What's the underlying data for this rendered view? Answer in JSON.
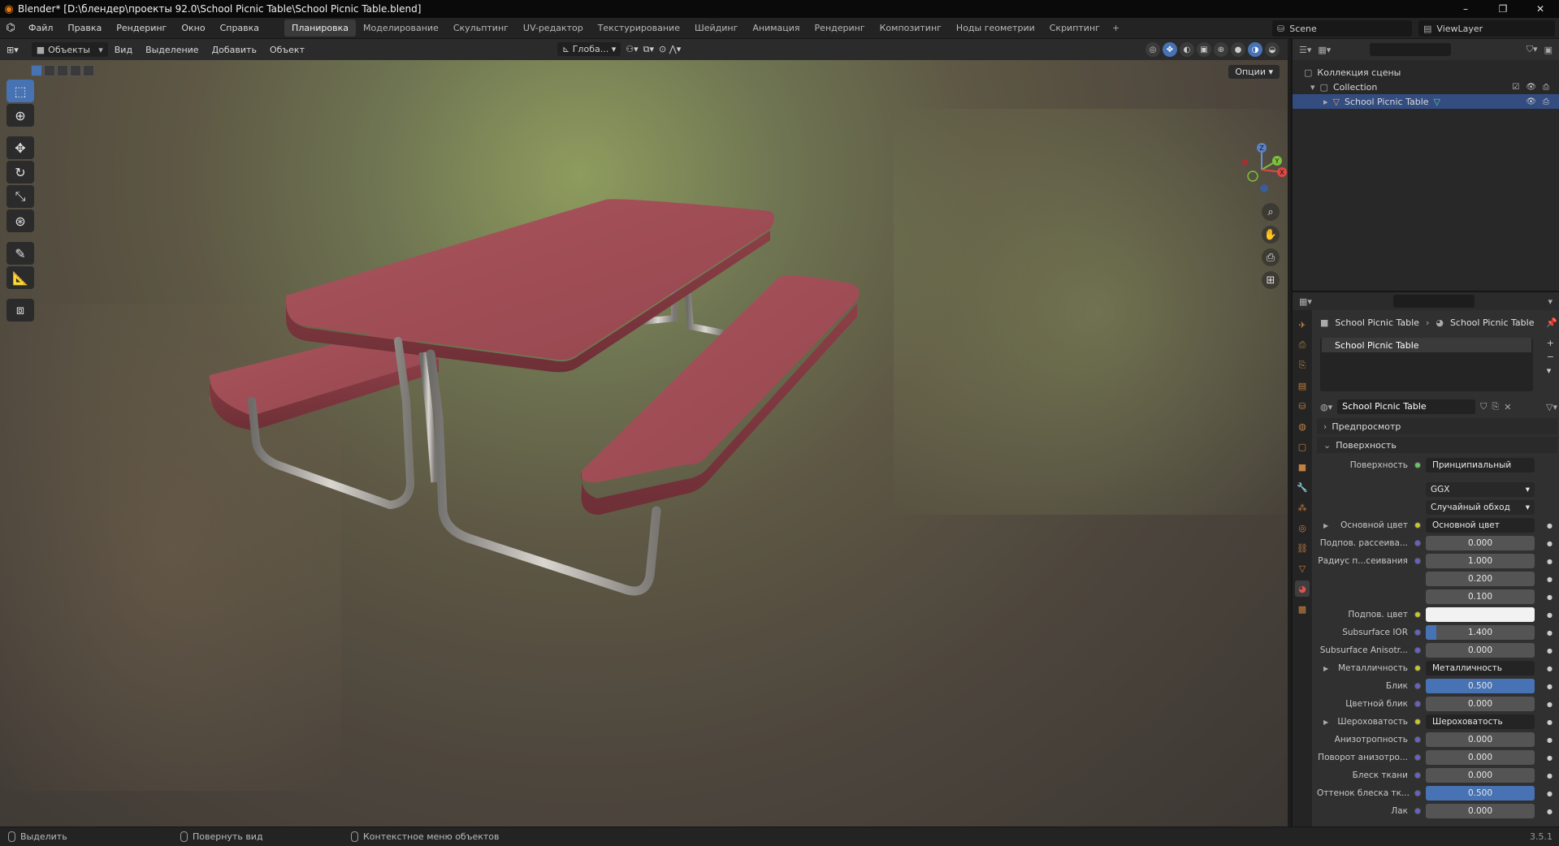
{
  "window": {
    "title": "Blender* [D:\\блендер\\проекты 92.0\\School Picnic Table\\School Picnic Table.blend]",
    "controls": [
      "–",
      "❐",
      "✕"
    ]
  },
  "menubar": {
    "menus": [
      "Файл",
      "Правка",
      "Рендеринг",
      "Окно",
      "Справка"
    ],
    "workspaces": [
      "Планировка",
      "Моделирование",
      "Скульптинг",
      "UV-редактор",
      "Текстурирование",
      "Шейдинг",
      "Анимация",
      "Рендеринг",
      "Композитинг",
      "Ноды геометрии",
      "Скриптинг"
    ],
    "active_workspace_index": 0,
    "add": "+",
    "scene": "Scene",
    "view_layer": "ViewLayer"
  },
  "viewport_header": {
    "mode": "Объекты",
    "menus": [
      "Вид",
      "Выделение",
      "Добавить",
      "Объект"
    ],
    "transform_orientation": "Глоба...",
    "options": "Опции"
  },
  "toolbar": {
    "tools": [
      "select-box",
      "cursor",
      "move",
      "rotate",
      "scale",
      "transform",
      "annotate",
      "measure",
      "add-cube"
    ]
  },
  "gizmo": {
    "x": "X",
    "y": "Y",
    "z": "Z"
  },
  "outliner": {
    "scene_collection": "Коллекция сцены",
    "collection": "Collection",
    "object": "School Picnic Table"
  },
  "properties": {
    "breadcrumb_object": "School Picnic Table",
    "breadcrumb_material": "School Picnic Table",
    "material_slot": "School Picnic Table",
    "material_name": "School Picnic Table",
    "panels": {
      "preview": "Предпросмотр",
      "surface": "Поверхность"
    },
    "surface_label": "Поверхность",
    "surface_shader": "Принципиальный BSDF",
    "distribution": "GGX",
    "subsurface_method": "Случайный обход",
    "rows": [
      {
        "label": "Основной цвет",
        "value": "Основной цвет",
        "kind": "link",
        "expand": true
      },
      {
        "label": "Подпов. рассеива...",
        "value": "0.000",
        "kind": "num"
      },
      {
        "label": "Радиус п...сеивания",
        "value": "1.000",
        "kind": "num"
      },
      {
        "label": "",
        "value": "0.200",
        "kind": "num"
      },
      {
        "label": "",
        "value": "0.100",
        "kind": "num"
      },
      {
        "label": "Подпов. цвет",
        "value": "",
        "kind": "white"
      },
      {
        "label": "Subsurface IOR",
        "value": "1.400",
        "kind": "num",
        "fill": 0.1
      },
      {
        "label": "Subsurface Anisotr...",
        "value": "0.000",
        "kind": "num"
      },
      {
        "label": "Металличность",
        "value": "Металличность",
        "kind": "link",
        "expand": true
      },
      {
        "label": "Блик",
        "value": "0.500",
        "kind": "num",
        "fill": 1.0
      },
      {
        "label": "Цветной блик",
        "value": "0.000",
        "kind": "num"
      },
      {
        "label": "Шероховатость",
        "value": "Шероховатость",
        "kind": "link",
        "expand": true
      },
      {
        "label": "Анизотропность",
        "value": "0.000",
        "kind": "num"
      },
      {
        "label": "Поворот анизотро...",
        "value": "0.000",
        "kind": "num"
      },
      {
        "label": "Блеск ткани",
        "value": "0.000",
        "kind": "num"
      },
      {
        "label": "Оттенок блеска тк...",
        "value": "0.500",
        "kind": "num",
        "fill": 1.0
      },
      {
        "label": "Лак",
        "value": "0.000",
        "kind": "num"
      }
    ]
  },
  "statusbar": {
    "select": "Выделить",
    "rotate_view": "Повернуть вид",
    "context_menu": "Контекстное меню объектов",
    "version": "3.5.1"
  },
  "colors": {
    "accent": "#4772b3",
    "table_top": "#9b4a52",
    "frame": "#b8b4ae"
  }
}
